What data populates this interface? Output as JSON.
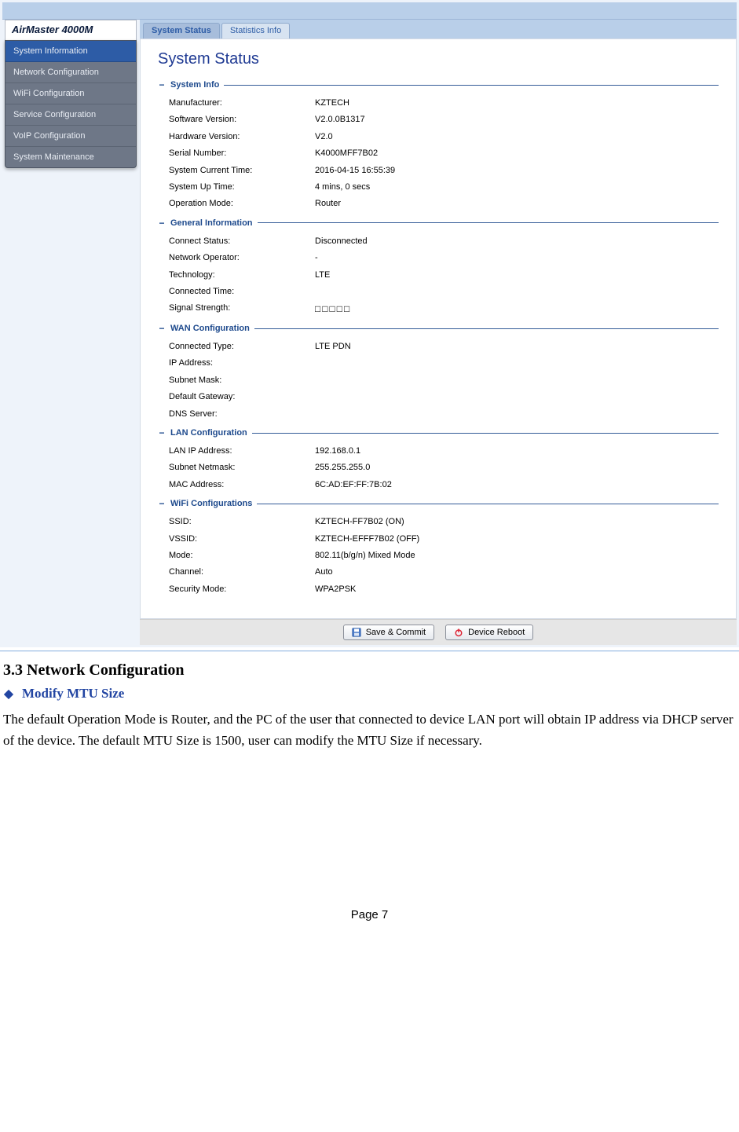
{
  "brand": "AirMaster 4000M",
  "sidebar": {
    "items": [
      {
        "label": "System Information",
        "active": true
      },
      {
        "label": "Network Configuration",
        "active": false
      },
      {
        "label": "WiFi Configuration",
        "active": false
      },
      {
        "label": "Service Configuration",
        "active": false
      },
      {
        "label": "VoIP Configuration",
        "active": false
      },
      {
        "label": "System Maintenance",
        "active": false
      }
    ]
  },
  "tabs": [
    {
      "label": "System Status",
      "active": true
    },
    {
      "label": "Statistics Info",
      "active": false
    }
  ],
  "page_title": "System Status",
  "sections": {
    "system_info": {
      "title": "System Info",
      "rows": [
        {
          "label": "Manufacturer:",
          "value": "KZTECH"
        },
        {
          "label": "Software Version:",
          "value": "V2.0.0B1317"
        },
        {
          "label": "Hardware Version:",
          "value": "V2.0"
        },
        {
          "label": "Serial Number:",
          "value": "K4000MFF7B02"
        },
        {
          "label": "System Current Time:",
          "value": "2016-04-15 16:55:39"
        },
        {
          "label": "System Up Time:",
          "value": "4 mins, 0 secs"
        },
        {
          "label": "Operation Mode:",
          "value": "Router"
        }
      ]
    },
    "general_info": {
      "title": "General Information",
      "rows": [
        {
          "label": "Connect Status:",
          "value": "Disconnected"
        },
        {
          "label": "Network Operator:",
          "value": "-"
        },
        {
          "label": "Technology:",
          "value": "LTE"
        },
        {
          "label": "Connected Time:",
          "value": ""
        },
        {
          "label": "Signal Strength:",
          "value": "□□□□□"
        }
      ]
    },
    "wan_config": {
      "title": "WAN Configuration",
      "rows": [
        {
          "label": "Connected Type:",
          "value": "LTE PDN"
        },
        {
          "label": "IP Address:",
          "value": ""
        },
        {
          "label": "Subnet Mask:",
          "value": ""
        },
        {
          "label": "Default Gateway:",
          "value": ""
        },
        {
          "label": "DNS Server:",
          "value": ""
        }
      ]
    },
    "lan_config": {
      "title": "LAN Configuration",
      "rows": [
        {
          "label": "LAN IP Address:",
          "value": "192.168.0.1"
        },
        {
          "label": "Subnet Netmask:",
          "value": "255.255.255.0"
        },
        {
          "label": "MAC Address:",
          "value": "6C:AD:EF:FF:7B:02"
        }
      ]
    },
    "wifi_config": {
      "title": "WiFi Configurations",
      "rows": [
        {
          "label": "SSID:",
          "value": "KZTECH-FF7B02   (ON)"
        },
        {
          "label": "VSSID:",
          "value": "KZTECH-EFFF7B02   (OFF)"
        },
        {
          "label": "Mode:",
          "value": "802.11(b/g/n) Mixed Mode"
        },
        {
          "label": "Channel:",
          "value": "Auto"
        },
        {
          "label": "Security Mode:",
          "value": "WPA2PSK"
        }
      ]
    }
  },
  "footer": {
    "save_label": "Save & Commit",
    "reboot_label": "Device Reboot"
  },
  "doc": {
    "heading": "3.3 Network Configuration",
    "subheading": "Modify MTU Size",
    "paragraph": "The default Operation Mode is Router, and the PC of the user that connected to device LAN port will obtain IP address via DHCP server of the device. The default MTU Size is 1500, user can modify the MTU Size if necessary.",
    "page_number": "Page 7"
  }
}
